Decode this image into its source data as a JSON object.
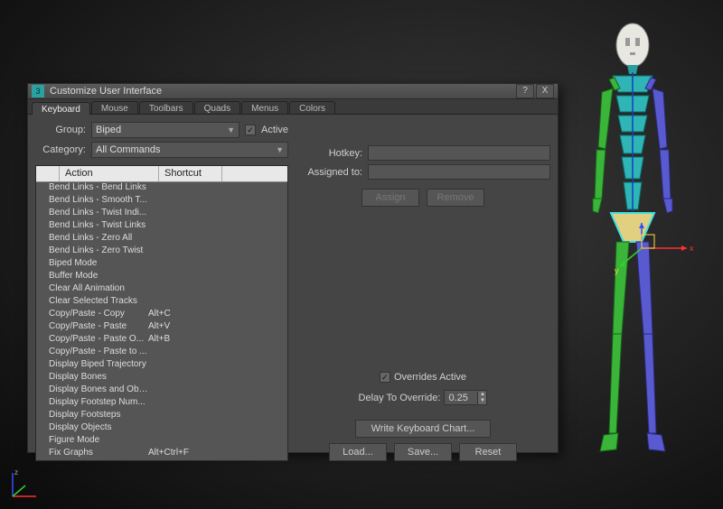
{
  "window": {
    "title": "Customize User Interface",
    "help_symbol": "?",
    "close_symbol": "X"
  },
  "tabs": [
    "Keyboard",
    "Mouse",
    "Toolbars",
    "Quads",
    "Menus",
    "Colors"
  ],
  "active_tab": 0,
  "group_label": "Group:",
  "group_value": "Biped",
  "active_checkbox_label": "Active",
  "active_checked": true,
  "category_label": "Category:",
  "category_value": "All Commands",
  "list_headers": {
    "action": "Action",
    "shortcut": "Shortcut"
  },
  "actions": [
    {
      "name": "Bend Links - Bend Links",
      "shortcut": ""
    },
    {
      "name": "Bend Links - Smooth T...",
      "shortcut": ""
    },
    {
      "name": "Bend Links - Twist Indi...",
      "shortcut": ""
    },
    {
      "name": "Bend Links - Twist Links",
      "shortcut": ""
    },
    {
      "name": "Bend Links - Zero All",
      "shortcut": ""
    },
    {
      "name": "Bend Links - Zero Twist",
      "shortcut": ""
    },
    {
      "name": "Biped Mode",
      "shortcut": ""
    },
    {
      "name": "Buffer Mode",
      "shortcut": ""
    },
    {
      "name": "Clear All Animation",
      "shortcut": ""
    },
    {
      "name": "Clear Selected Tracks",
      "shortcut": ""
    },
    {
      "name": "Copy/Paste - Copy",
      "shortcut": "Alt+C"
    },
    {
      "name": "Copy/Paste - Paste",
      "shortcut": "Alt+V"
    },
    {
      "name": "Copy/Paste - Paste O...",
      "shortcut": "Alt+B"
    },
    {
      "name": "Copy/Paste - Paste to ...",
      "shortcut": ""
    },
    {
      "name": "Display Biped Trajectory",
      "shortcut": ""
    },
    {
      "name": "Display Bones",
      "shortcut": ""
    },
    {
      "name": "Display Bones and Obj...",
      "shortcut": ""
    },
    {
      "name": "Display Footstep Num...",
      "shortcut": ""
    },
    {
      "name": "Display Footsteps",
      "shortcut": ""
    },
    {
      "name": "Display Objects",
      "shortcut": ""
    },
    {
      "name": "Figure Mode",
      "shortcut": ""
    },
    {
      "name": "Fix Graphs",
      "shortcut": "Alt+Ctrl+F"
    }
  ],
  "hotkey_label": "Hotkey:",
  "hotkey_value": "",
  "assigned_label": "Assigned to:",
  "assigned_value": "",
  "assign_btn": "Assign",
  "remove_btn": "Remove",
  "overrides_label": "Overrides Active",
  "overrides_checked": true,
  "delay_label": "Delay To Override:",
  "delay_value": "0.25",
  "write_chart_btn": "Write Keyboard Chart...",
  "load_btn": "Load...",
  "save_btn": "Save...",
  "reset_btn": "Reset",
  "axis_labels": {
    "x": "x",
    "y": "y",
    "z": "z"
  }
}
